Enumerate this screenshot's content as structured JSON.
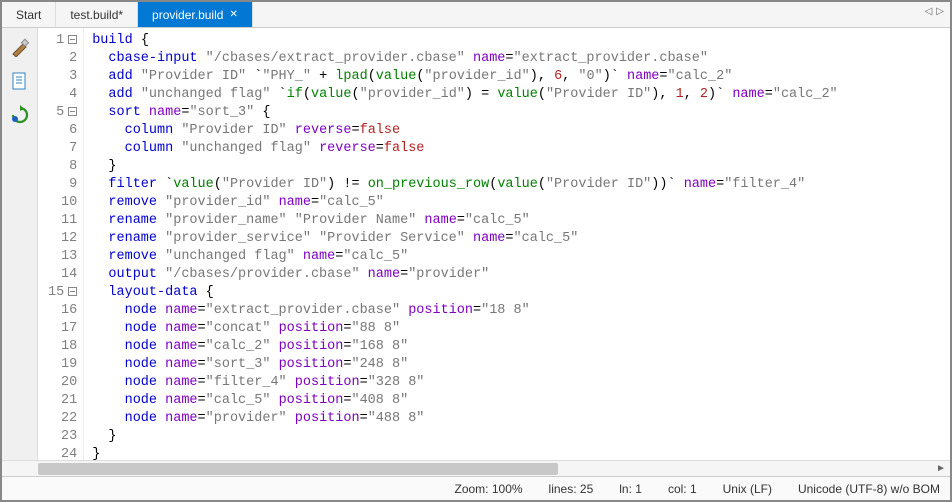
{
  "tabs": [
    {
      "label": "Start",
      "active": false,
      "closable": false
    },
    {
      "label": "test.build*",
      "active": false,
      "closable": false
    },
    {
      "label": "provider.build",
      "active": true,
      "closable": true
    }
  ],
  "status": {
    "zoom": "Zoom: 100%",
    "lines": "lines: 25",
    "ln": "ln: 1",
    "col": "col: 1",
    "eol": "Unix (LF)",
    "encoding": "Unicode (UTF-8) w/o BOM"
  },
  "line_count": 25,
  "fold_lines": [
    1,
    5,
    15
  ],
  "code": [
    [
      [
        "kw",
        "build"
      ],
      [
        "brace",
        " {"
      ]
    ],
    [
      [
        "",
        "  "
      ],
      [
        "kw",
        "cbase-input"
      ],
      [
        "",
        " "
      ],
      [
        "str",
        "\"/cbases/extract_provider.cbase\""
      ],
      [
        "",
        " "
      ],
      [
        "pur",
        "name"
      ],
      [
        "",
        "="
      ],
      [
        "str",
        "\"extract_provider.cbase\""
      ]
    ],
    [
      [
        "",
        "  "
      ],
      [
        "kw",
        "add"
      ],
      [
        "",
        " "
      ],
      [
        "str",
        "\"Provider ID\""
      ],
      [
        "",
        " `"
      ],
      [
        "str",
        "\"PHY_\""
      ],
      [
        "",
        " + "
      ],
      [
        "grn",
        "lpad"
      ],
      [
        "",
        "("
      ],
      [
        "grn",
        "value"
      ],
      [
        "",
        "("
      ],
      [
        "str",
        "\"provider_id\""
      ],
      [
        "",
        "), "
      ],
      [
        "val",
        "6"
      ],
      [
        "",
        ", "
      ],
      [
        "str",
        "\"0\""
      ],
      [
        "",
        ")` "
      ],
      [
        "pur",
        "name"
      ],
      [
        "",
        "="
      ],
      [
        "str",
        "\"calc_2\""
      ]
    ],
    [
      [
        "",
        "  "
      ],
      [
        "kw",
        "add"
      ],
      [
        "",
        " "
      ],
      [
        "str",
        "\"unchanged flag\""
      ],
      [
        "",
        " `"
      ],
      [
        "grn",
        "if"
      ],
      [
        "",
        "("
      ],
      [
        "grn",
        "value"
      ],
      [
        "",
        "("
      ],
      [
        "str",
        "\"provider_id\""
      ],
      [
        "",
        ") = "
      ],
      [
        "grn",
        "value"
      ],
      [
        "",
        "("
      ],
      [
        "str",
        "\"Provider ID\""
      ],
      [
        "",
        "), "
      ],
      [
        "val",
        "1"
      ],
      [
        "",
        ", "
      ],
      [
        "val",
        "2"
      ],
      [
        "",
        ")` "
      ],
      [
        "pur",
        "name"
      ],
      [
        "",
        "="
      ],
      [
        "str",
        "\"calc_2\""
      ]
    ],
    [
      [
        "",
        "  "
      ],
      [
        "kw",
        "sort"
      ],
      [
        "",
        " "
      ],
      [
        "pur",
        "name"
      ],
      [
        "",
        "="
      ],
      [
        "str",
        "\"sort_3\""
      ],
      [
        "brace",
        " {"
      ]
    ],
    [
      [
        "",
        "    "
      ],
      [
        "kw",
        "column"
      ],
      [
        "",
        " "
      ],
      [
        "str",
        "\"Provider ID\""
      ],
      [
        "",
        " "
      ],
      [
        "pur",
        "reverse"
      ],
      [
        "",
        "="
      ],
      [
        "val",
        "false"
      ]
    ],
    [
      [
        "",
        "    "
      ],
      [
        "kw",
        "column"
      ],
      [
        "",
        " "
      ],
      [
        "str",
        "\"unchanged flag\""
      ],
      [
        "",
        " "
      ],
      [
        "pur",
        "reverse"
      ],
      [
        "",
        "="
      ],
      [
        "val",
        "false"
      ]
    ],
    [
      [
        "",
        "  "
      ],
      [
        "brace",
        "}"
      ]
    ],
    [
      [
        "",
        "  "
      ],
      [
        "kw",
        "filter"
      ],
      [
        "",
        " `"
      ],
      [
        "grn",
        "value"
      ],
      [
        "",
        "("
      ],
      [
        "str",
        "\"Provider ID\""
      ],
      [
        "",
        ") != "
      ],
      [
        "grn",
        "on_previous_row"
      ],
      [
        "",
        "("
      ],
      [
        "grn",
        "value"
      ],
      [
        "",
        "("
      ],
      [
        "str",
        "\"Provider ID\""
      ],
      [
        "",
        "))` "
      ],
      [
        "pur",
        "name"
      ],
      [
        "",
        "="
      ],
      [
        "str",
        "\"filter_4\""
      ]
    ],
    [
      [
        "",
        "  "
      ],
      [
        "kw",
        "remove"
      ],
      [
        "",
        " "
      ],
      [
        "str",
        "\"provider_id\""
      ],
      [
        "",
        " "
      ],
      [
        "pur",
        "name"
      ],
      [
        "",
        "="
      ],
      [
        "str",
        "\"calc_5\""
      ]
    ],
    [
      [
        "",
        "  "
      ],
      [
        "kw",
        "rename"
      ],
      [
        "",
        " "
      ],
      [
        "str",
        "\"provider_name\""
      ],
      [
        "",
        " "
      ],
      [
        "str",
        "\"Provider Name\""
      ],
      [
        "",
        " "
      ],
      [
        "pur",
        "name"
      ],
      [
        "",
        "="
      ],
      [
        "str",
        "\"calc_5\""
      ]
    ],
    [
      [
        "",
        "  "
      ],
      [
        "kw",
        "rename"
      ],
      [
        "",
        " "
      ],
      [
        "str",
        "\"provider_service\""
      ],
      [
        "",
        " "
      ],
      [
        "str",
        "\"Provider Service\""
      ],
      [
        "",
        " "
      ],
      [
        "pur",
        "name"
      ],
      [
        "",
        "="
      ],
      [
        "str",
        "\"calc_5\""
      ]
    ],
    [
      [
        "",
        "  "
      ],
      [
        "kw",
        "remove"
      ],
      [
        "",
        " "
      ],
      [
        "str",
        "\"unchanged flag\""
      ],
      [
        "",
        " "
      ],
      [
        "pur",
        "name"
      ],
      [
        "",
        "="
      ],
      [
        "str",
        "\"calc_5\""
      ]
    ],
    [
      [
        "",
        "  "
      ],
      [
        "kw",
        "output"
      ],
      [
        "",
        " "
      ],
      [
        "str",
        "\"/cbases/provider.cbase\""
      ],
      [
        "",
        " "
      ],
      [
        "pur",
        "name"
      ],
      [
        "",
        "="
      ],
      [
        "str",
        "\"provider\""
      ]
    ],
    [
      [
        "",
        "  "
      ],
      [
        "kw",
        "layout-data"
      ],
      [
        "brace",
        " {"
      ]
    ],
    [
      [
        "",
        "    "
      ],
      [
        "kw",
        "node"
      ],
      [
        "",
        " "
      ],
      [
        "pur",
        "name"
      ],
      [
        "",
        "="
      ],
      [
        "str",
        "\"extract_provider.cbase\""
      ],
      [
        "",
        " "
      ],
      [
        "pur",
        "position"
      ],
      [
        "",
        "="
      ],
      [
        "str",
        "\"18 8\""
      ]
    ],
    [
      [
        "",
        "    "
      ],
      [
        "kw",
        "node"
      ],
      [
        "",
        " "
      ],
      [
        "pur",
        "name"
      ],
      [
        "",
        "="
      ],
      [
        "str",
        "\"concat\""
      ],
      [
        "",
        " "
      ],
      [
        "pur",
        "position"
      ],
      [
        "",
        "="
      ],
      [
        "str",
        "\"88 8\""
      ]
    ],
    [
      [
        "",
        "    "
      ],
      [
        "kw",
        "node"
      ],
      [
        "",
        " "
      ],
      [
        "pur",
        "name"
      ],
      [
        "",
        "="
      ],
      [
        "str",
        "\"calc_2\""
      ],
      [
        "",
        " "
      ],
      [
        "pur",
        "position"
      ],
      [
        "",
        "="
      ],
      [
        "str",
        "\"168 8\""
      ]
    ],
    [
      [
        "",
        "    "
      ],
      [
        "kw",
        "node"
      ],
      [
        "",
        " "
      ],
      [
        "pur",
        "name"
      ],
      [
        "",
        "="
      ],
      [
        "str",
        "\"sort_3\""
      ],
      [
        "",
        " "
      ],
      [
        "pur",
        "position"
      ],
      [
        "",
        "="
      ],
      [
        "str",
        "\"248 8\""
      ]
    ],
    [
      [
        "",
        "    "
      ],
      [
        "kw",
        "node"
      ],
      [
        "",
        " "
      ],
      [
        "pur",
        "name"
      ],
      [
        "",
        "="
      ],
      [
        "str",
        "\"filter_4\""
      ],
      [
        "",
        " "
      ],
      [
        "pur",
        "position"
      ],
      [
        "",
        "="
      ],
      [
        "str",
        "\"328 8\""
      ]
    ],
    [
      [
        "",
        "    "
      ],
      [
        "kw",
        "node"
      ],
      [
        "",
        " "
      ],
      [
        "pur",
        "name"
      ],
      [
        "",
        "="
      ],
      [
        "str",
        "\"calc_5\""
      ],
      [
        "",
        " "
      ],
      [
        "pur",
        "position"
      ],
      [
        "",
        "="
      ],
      [
        "str",
        "\"408 8\""
      ]
    ],
    [
      [
        "",
        "    "
      ],
      [
        "kw",
        "node"
      ],
      [
        "",
        " "
      ],
      [
        "pur",
        "name"
      ],
      [
        "",
        "="
      ],
      [
        "str",
        "\"provider\""
      ],
      [
        "",
        " "
      ],
      [
        "pur",
        "position"
      ],
      [
        "",
        "="
      ],
      [
        "str",
        "\"488 8\""
      ]
    ],
    [
      [
        "",
        "  "
      ],
      [
        "brace",
        "}"
      ]
    ],
    [
      [
        "brace",
        "}"
      ]
    ],
    [
      [
        "",
        ""
      ]
    ]
  ]
}
